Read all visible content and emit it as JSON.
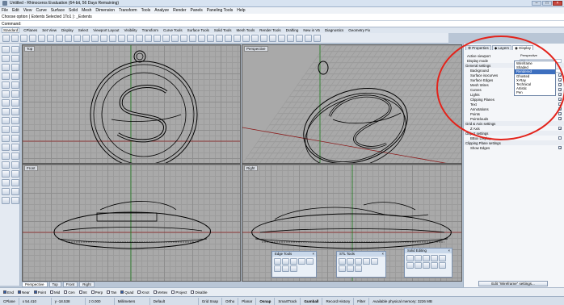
{
  "window": {
    "title": "Untitled - Rhinoceros Evaluation (64-bit, 56 Days Remaining)"
  },
  "menu": [
    "File",
    "Edit",
    "View",
    "Curve",
    "Surface",
    "Solid",
    "Mesh",
    "Dimension",
    "Transform",
    "Tools",
    "Analyze",
    "Render",
    "Panels",
    "Paneling Tools",
    "Help"
  ],
  "command": {
    "history": "Choose option ( Extents  Selected  1To1 ): _Extents",
    "prompt": "Command:"
  },
  "tabs": [
    "Standard",
    "CPlanes",
    "Set View",
    "Display",
    "Select",
    "Viewport Layout",
    "Visibility",
    "Transform",
    "Curve Tools",
    "Surface Tools",
    "Solid Tools",
    "Mesh Tools",
    "Render Tools",
    "Drafting",
    "New in V5",
    "Diagnostics",
    "Geometry Fix"
  ],
  "viewports": {
    "top": "Top",
    "perspective": "Perspective",
    "front": "Front",
    "right": "Right"
  },
  "viewport_tabs": [
    "Perspective",
    "Top",
    "Front",
    "Right"
  ],
  "osnaps": [
    {
      "label": "End",
      "on": true
    },
    {
      "label": "Near",
      "on": true
    },
    {
      "label": "Point",
      "on": true
    },
    {
      "label": "Mid",
      "on": false
    },
    {
      "label": "Cen",
      "on": false
    },
    {
      "label": "Int",
      "on": false
    },
    {
      "label": "Perp",
      "on": false
    },
    {
      "label": "Tan",
      "on": false
    },
    {
      "label": "Quad",
      "on": true
    },
    {
      "label": "Knot",
      "on": false
    },
    {
      "label": "Vertex",
      "on": false
    },
    {
      "label": "Project",
      "on": false
    },
    {
      "label": "Disable",
      "on": false
    }
  ],
  "status": {
    "cplane": "CPlane",
    "x": "x 54.410",
    "y": "y -18.538",
    "z": "z 0.000",
    "units": "Millimeters",
    "layer": "Default",
    "grid_snap": "Grid Snap",
    "ortho": "Ortho",
    "planar": "Planar",
    "osnap": "Osnap",
    "smarttrack": "SmartTrack",
    "gumball": "Gumball",
    "record_history": "Record History",
    "filter": "Filter",
    "memory": "Available physical memory: 3226 MB"
  },
  "panel": {
    "tabs": [
      "Properties",
      "Layers",
      "Display"
    ],
    "active_viewport_label": "Active viewport",
    "active_viewport_value": "Perspective",
    "display_mode_label": "Display mode",
    "display_mode_value": "Wireframe",
    "dropdown": [
      "Wireframe",
      "Shaded",
      "Rendered",
      "Ghosted",
      "X-Ray",
      "Technical",
      "Artistic",
      "Pen"
    ],
    "dropdown_selected": 2,
    "general": "General settings",
    "rows": [
      {
        "label": "Background",
        "kind": "value"
      },
      {
        "label": "Surface isocurves",
        "kind": "check"
      },
      {
        "label": "Surface Edges",
        "kind": "check"
      },
      {
        "label": "Mesh Wires",
        "kind": "check"
      },
      {
        "label": "Curves",
        "kind": "check"
      },
      {
        "label": "Lights",
        "kind": "check"
      },
      {
        "label": "Clipping Planes",
        "kind": "check"
      },
      {
        "label": "Text",
        "kind": "check"
      },
      {
        "label": "Annotations",
        "kind": "check"
      },
      {
        "label": "Points",
        "kind": "check"
      },
      {
        "label": "Pointclouds",
        "kind": "check"
      }
    ],
    "grid_axes": "Grid & Axis settings",
    "z_axis": "Z Axis",
    "object_settings": "Object settings",
    "bbox": "BBox Display",
    "clipping_settings": "Clipping Plane settings",
    "show_edges": "Show Edges",
    "edit_button": "Edit \"Wireframe\" settings..."
  },
  "floating": [
    {
      "title": "Edge Tools"
    },
    {
      "title": "STL Tools"
    },
    {
      "title": "Solid Editing"
    }
  ]
}
